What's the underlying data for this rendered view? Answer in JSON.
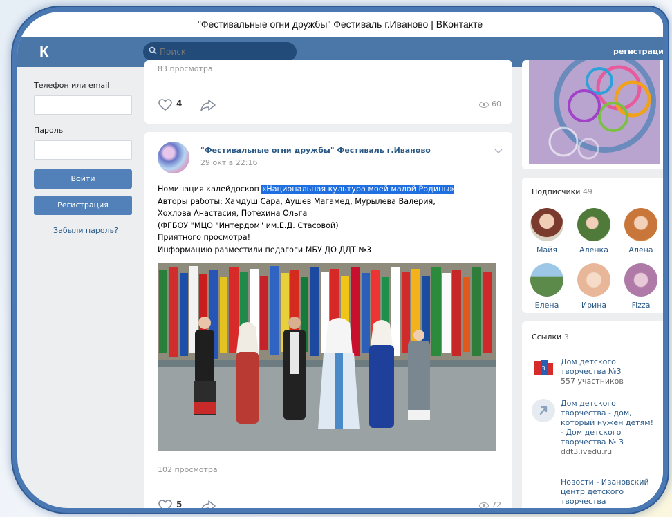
{
  "window": {
    "title": "\"Фестивальные огни дружбы\" Фестиваль г.Иваново | ВКонтакте"
  },
  "header": {
    "logo": "К",
    "search_placeholder": "Поиск",
    "register_link": "регистрация"
  },
  "login": {
    "phone_label": "Телефон или email",
    "password_label": "Пароль",
    "login_button": "Войти",
    "register_button": "Регистрация",
    "forgot_link": "Забыли пароль?"
  },
  "feed": {
    "prev_post": {
      "views_text": "83 просмотра",
      "likes": "4",
      "views": "60"
    },
    "post": {
      "community": "\"Фестивальные огни дружбы\" Фестиваль г.Иваново",
      "date": "29 окт в 22:16",
      "text_prefix": "Номинация калейдоскоп ",
      "text_highlight": "«Национальная культура моей малой Родины»",
      "lines": [
        "Авторы работы: Хамдуш Сара, Аушев Магамед, Мурылева Валерия,",
        "Хохлова Анастасия, Потехина Ольга",
        "(ФГБОУ \"МЦО \"Интердом\" им.Е.Д. Стасовой)",
        "Приятного просмотра!",
        "Информацию разместили педагоги МБУ ДО ДДТ №3"
      ],
      "views_text": "102 просмотра",
      "likes": "5",
      "views": "72"
    }
  },
  "sidebar": {
    "subscribers": {
      "title": "Подписчики",
      "count": "49",
      "people": [
        {
          "name": "Майя",
          "color": "#7a3b2e"
        },
        {
          "name": "Аленка",
          "color": "#4f7a3a"
        },
        {
          "name": "Алёна",
          "color": "#c8763a"
        },
        {
          "name": "Елена",
          "color": "#5c8a4a"
        },
        {
          "name": "Ирина",
          "color": "#e8b79a"
        },
        {
          "name": "Fizza",
          "color": "#b07aa8"
        }
      ]
    },
    "links": {
      "title": "Ссылки",
      "count": "3",
      "items": [
        {
          "title": "Дом детского творчества №3",
          "sub": "557 участников"
        },
        {
          "title": "Дом детского творчества - дом, который нужен детям! - Дом детского творчества № 3",
          "sub": "ddt3.ivedu.ru"
        },
        {
          "title": "Новости - Ивановский центр детского творчества",
          "sub": ""
        }
      ]
    }
  }
}
